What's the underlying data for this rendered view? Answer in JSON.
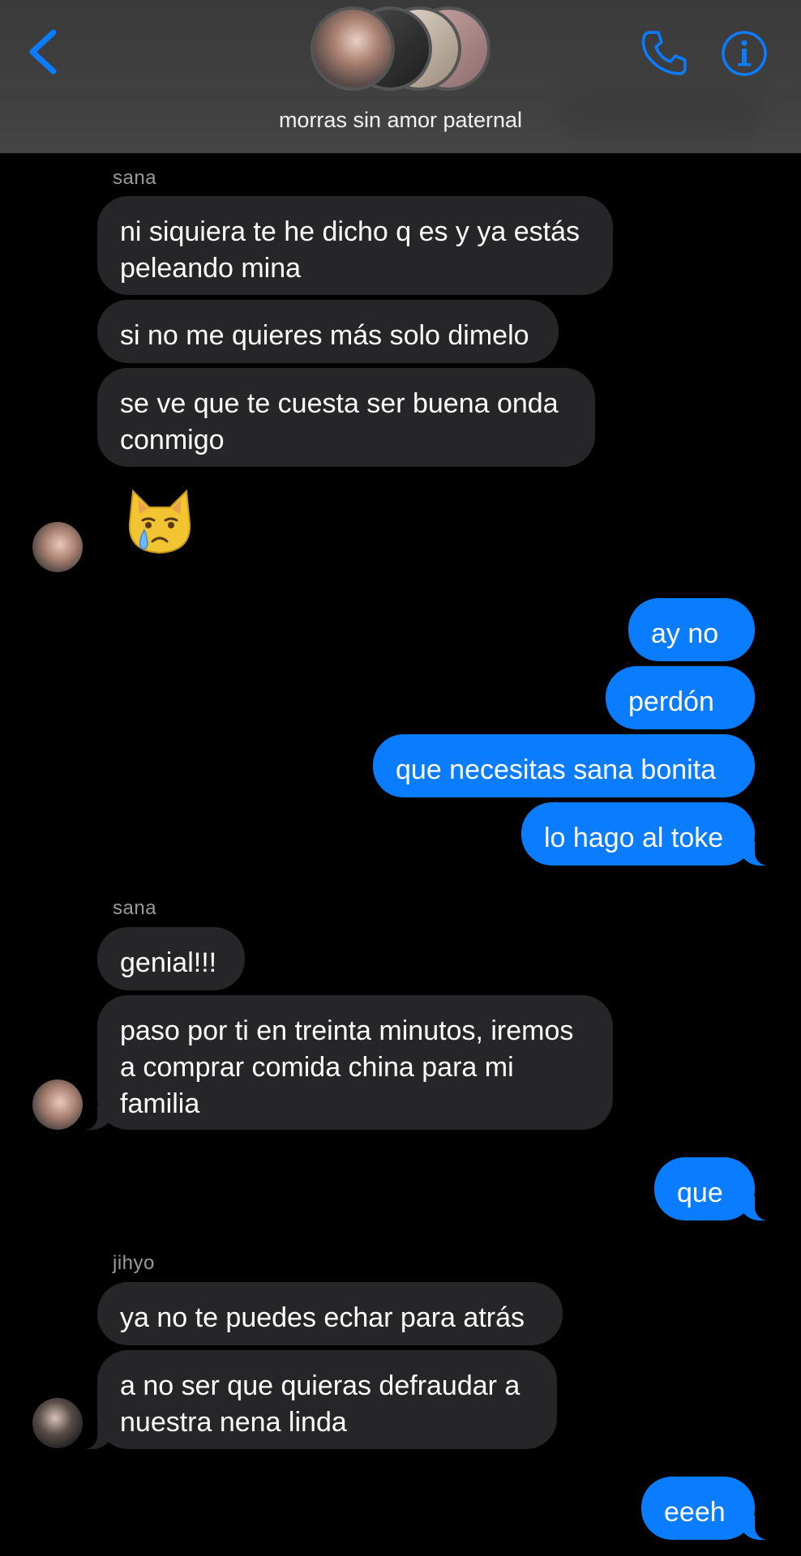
{
  "header": {
    "title": "morras sin amor paternal",
    "back_icon": "chevron-left-icon",
    "call_icon": "phone-icon",
    "info_icon": "info-icon",
    "accent": "#0a7cff"
  },
  "messages": [
    {
      "sender": "sana"
    },
    {
      "text": "ni siquiera te he dicho q es y ya estás\npeleando mina"
    },
    {
      "text": "si no me quieres más solo dimelo"
    },
    {
      "text": "se ve que te cuesta ser buena onda\nconmigo"
    },
    {
      "emoji": "crying-cat-icon"
    },
    {
      "text": "ay no"
    },
    {
      "text": "perdón"
    },
    {
      "text": "que necesitas sana bonita"
    },
    {
      "text": "lo hago al toke"
    },
    {
      "sender": "sana"
    },
    {
      "text": "genial!!!"
    },
    {
      "text": "paso por ti en treinta minutos, iremos\na comprar comida china para mi\nfamilia"
    },
    {
      "text": "que"
    },
    {
      "sender": "jihyo"
    },
    {
      "text": "ya no te puedes echar para atrás"
    },
    {
      "text": "a no ser que quieras defraudar a\nnuestra nena linda"
    },
    {
      "text": "eeeh"
    }
  ]
}
